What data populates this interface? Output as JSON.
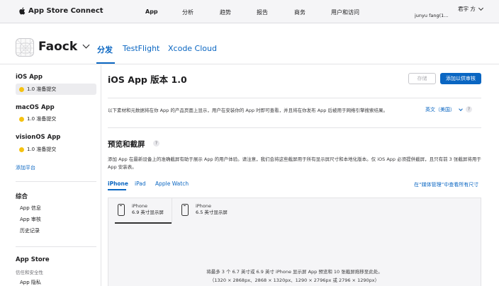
{
  "topnav": {
    "brand": "App Store Connect",
    "items": [
      "App",
      "分析",
      "趋势",
      "报告",
      "商务",
      "用户和访问"
    ],
    "user_name": "君宇 方",
    "user_sub": "junyu fang(1..."
  },
  "app": {
    "name": "Faock",
    "tabs": [
      "分发",
      "TestFlight",
      "Xcode Cloud"
    ]
  },
  "sidebar": {
    "ios_title": "iOS App",
    "ios_version": "1.0 准备提交",
    "macos_title": "macOS App",
    "macos_version": "1.0 准备提交",
    "visionos_title": "visionOS App",
    "visionos_version": "1.0 准备提交",
    "add_platform": "添加平台",
    "general_title": "综合",
    "general_items": [
      "App 信息",
      "App 审核",
      "历史记录"
    ],
    "appstore_title": "App Store",
    "appstore_sub": "信任和安全性",
    "appstore_item": "App 隐私"
  },
  "main": {
    "title": "iOS App 版本 1.0",
    "save_label": "存储",
    "submit_label": "添加以供审核",
    "description": "以下素材和元数据将在你 App 的产品页面上显示，用户在安装你的 App 时即可查看，并且将在你发布 App 后被用于网络引擎搜索结果。",
    "language": "英文（美国）",
    "help": "?",
    "section_title": "预览和截屏",
    "section_desc": "添加 App 在最新设备上的准确截屏有助于展示 App 的用户体验。请注意，我们会将这些截屏用于所有显示屏尺寸和本地化版本。仅 iOS App 必须提供截屏，且只有前 3 张截屏将用于 App 安装表。",
    "device_tabs": [
      "iPhone",
      "iPad",
      "Apple Watch"
    ],
    "media_link": "在“媒体管理”中查看所有尺寸",
    "sizes": [
      {
        "device": "iPhone",
        "size": "6.9 英寸显示屏"
      },
      {
        "device": "iPhone",
        "size": "6.5 英寸显示屏"
      }
    ],
    "drop_line1": "将最多 3 个 6.7 英寸或 6.9 英寸 iPhone 显示屏 App 预览和 10 张截屏拖移至此处。",
    "drop_line2": "（1320 × 2868px、2868 × 1320px、1290 × 2796px 或 2796 × 1290px）"
  },
  "colors": {
    "accent": "#0a66c2",
    "status_dot": "#f5c211"
  }
}
